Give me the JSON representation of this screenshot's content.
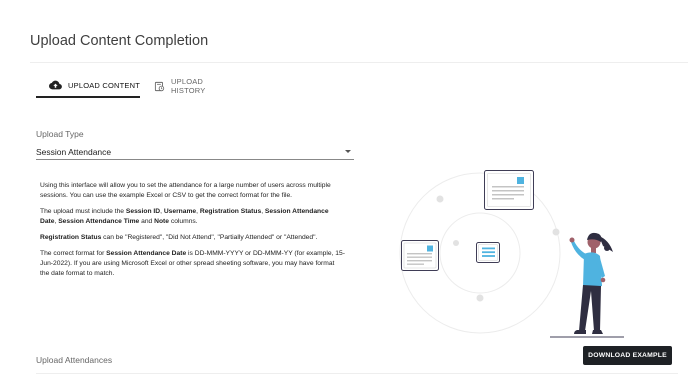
{
  "page": {
    "title": "Upload Content Completion"
  },
  "tabs": [
    {
      "label": "UPLOAD CONTENT",
      "icon": "cloud-upload-icon",
      "active": true
    },
    {
      "label": "UPLOAD HISTORY",
      "icon": "history-icon",
      "active": false
    }
  ],
  "upload_type": {
    "label": "Upload Type",
    "value": "Session Attendance"
  },
  "info": {
    "p1": "Using this interface will allow you to set the attendance for a large number of users across multiple sessions. You can use the example Excel or CSV to get the correct format for the file.",
    "p2": {
      "pre": "The upload must include the ",
      "f1": "Session ID",
      "s1": ", ",
      "f2": "Username",
      "s2": ", ",
      "f3": "Registration Status",
      "s3": ", ",
      "f4": "Session Attendance Date",
      "s4": ", ",
      "f5": "Session Attendance Time",
      "s5": " and ",
      "f6": "Note",
      "post": " columns."
    },
    "p3": {
      "bold": "Registration Status",
      "rest": " can be \"Registered\", \"Did Not Attend\", \"Partially Attended\" or \"Attended\"."
    },
    "p4": {
      "pre": "The correct format for ",
      "bold": "Session Attendance Date",
      "rest": " is DD-MMM-YYYY or DD-MMM-YY (for example, 15-Jun-2022). If you are using Microsoft Excel or other spread sheeting software, you may have format the date format to match."
    }
  },
  "download_button": {
    "label": "DOWNLOAD EXAMPLE"
  },
  "upload_section": {
    "label": "Upload Attendances"
  },
  "colors": {
    "accent": "#4fb3e0",
    "dark": "#1e2125",
    "skin": "#a0616a",
    "hair": "#2f2e41"
  }
}
